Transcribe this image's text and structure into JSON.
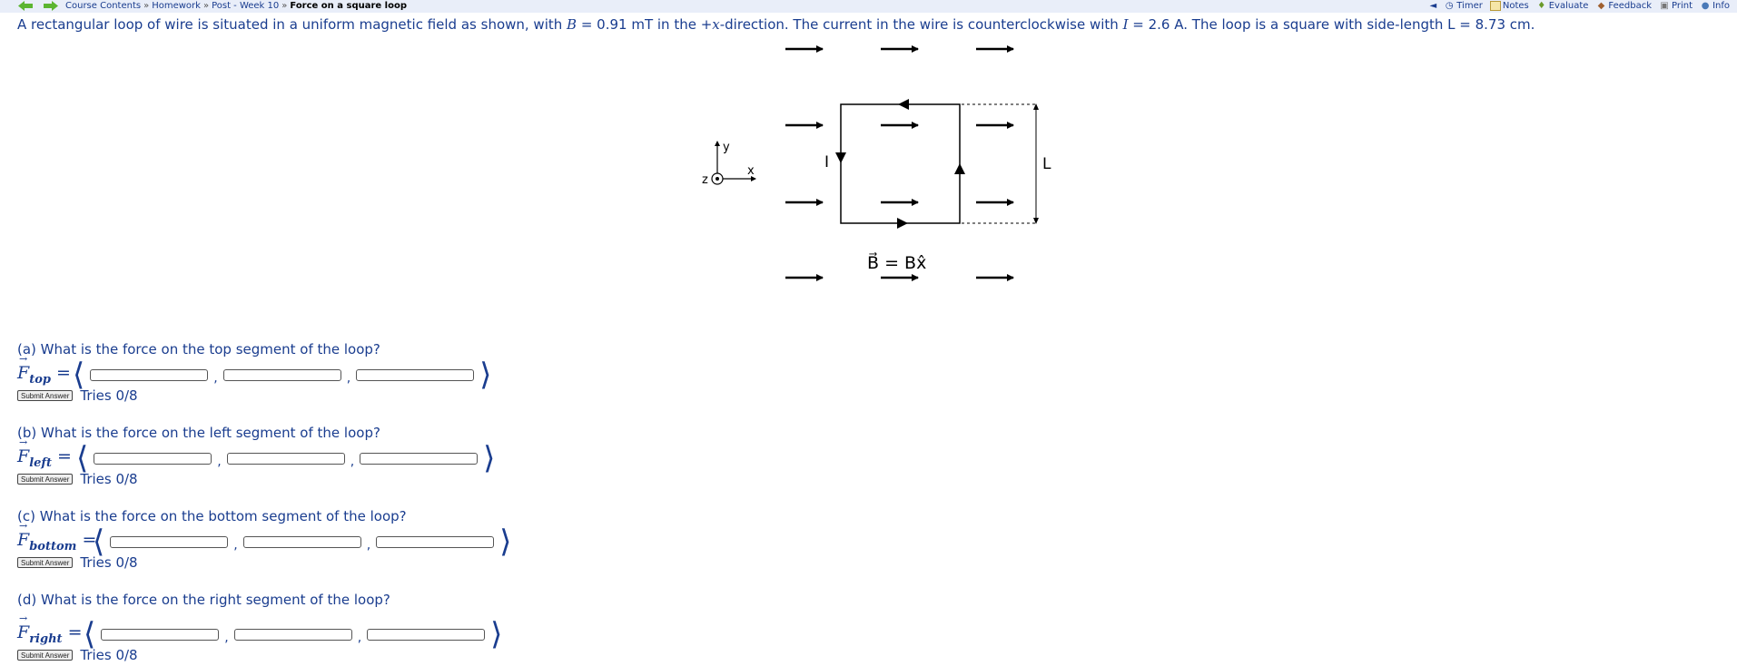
{
  "breadcrumb": {
    "items": [
      "Course Contents",
      "Homework",
      "Post - Week 10"
    ],
    "current": "Force on a square loop",
    "separator": "»"
  },
  "toolbar": {
    "back": "◄",
    "timer": "Timer",
    "notes": "Notes",
    "evaluate": "Evaluate",
    "feedback": "Feedback",
    "print": "Print",
    "info": "Info"
  },
  "problem": {
    "p1": "A rectangular loop of wire is situated in a uniform magnetic field as shown, with ",
    "B_sym": "B",
    "p2": " = 0.91 mT in the +",
    "x_sym": "x",
    "p3": "-direction. The current in the wire is counterclockwise with ",
    "I_sym": "I",
    "p4": " = 2.6 A. The loop is a square with side-length L = 8.73 cm."
  },
  "figure": {
    "axis_y": "y",
    "axis_x": "x",
    "axis_z": "z",
    "current_label": "I",
    "side_label": "L",
    "field_label": "B⃗ = Bx̂"
  },
  "parts": [
    {
      "question": "(a) What is the force on the top segment of the loop?",
      "sub": "top",
      "tries": "Tries 0/8",
      "submit": "Submit Answer"
    },
    {
      "question": "(b) What is the force on the left segment of the loop?",
      "sub": "left",
      "tries": "Tries 0/8",
      "submit": "Submit Answer"
    },
    {
      "question": "(c) What is the force on the bottom segment of the loop?",
      "sub": "bottom",
      "tries": "Tries 0/8",
      "submit": "Submit Answer"
    },
    {
      "question": "(d) What is the force on the right segment of the loop?",
      "sub": "right",
      "tries": "Tries 0/8",
      "submit": "Submit Answer"
    }
  ],
  "symbols": {
    "F": "F",
    "eq": "=",
    "langle": "⟨",
    "rangle": "⟩",
    "comma": ","
  },
  "colors": {
    "text": "#1a3d8f",
    "topbar": "#e9eef9",
    "nav_arrow": "#5cb531"
  }
}
